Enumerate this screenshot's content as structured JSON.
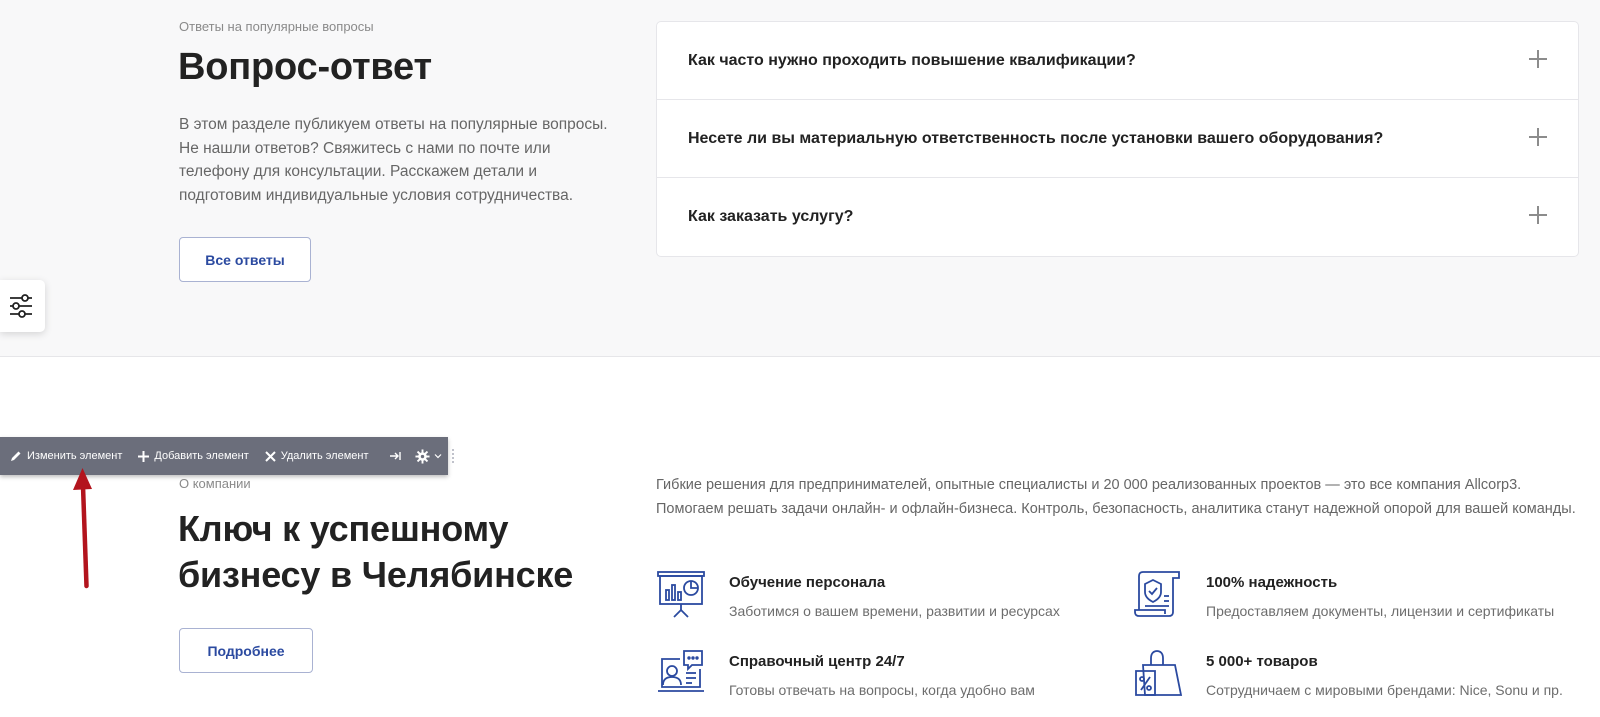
{
  "faq": {
    "caption": "Ответы на популярные вопросы",
    "title": "Вопрос-ответ",
    "description": "В этом разделе публикуем ответы на популярные вопросы. Не нашли ответов? Свяжитесь с нами по почте или телефону для консультации. Расскажем детали и подготовим индивидуальные условия сотрудничества.",
    "button_label": "Все ответы",
    "items": [
      {
        "question": "Как часто нужно проходить повышение квалификации?"
      },
      {
        "question": "Несете ли вы материальную ответственность после установки вашего оборудования?"
      },
      {
        "question": "Как заказать услугу?"
      }
    ]
  },
  "edit_toolbar": {
    "edit_label": "Изменить элемент",
    "add_label": "Добавить элемент",
    "delete_label": "Удалить элемент"
  },
  "about": {
    "caption": "О компании",
    "title": "Ключ к успешному бизнесу в Челябинске",
    "button_label": "Подробнее",
    "description": "Гибкие решения для предпринимателей, опытные специалисты и 20 000 реализованных проектов — это все компания Allcorp3. Помогаем решать задачи онлайн- и офлайн-бизнеса. Контроль, безопасность, аналитика станут надежной опорой для вашей команды.",
    "features": [
      {
        "icon": "presentation-board-icon",
        "title": "Обучение персонала",
        "desc": "Заботимся о вашем времени, развитии и ресурсах"
      },
      {
        "icon": "certificate-shield-icon",
        "title": "100% надежность",
        "desc": "Предоставляем документы, лицензии и сертификаты"
      },
      {
        "icon": "support-chat-icon",
        "title": "Справочный центр 24/7",
        "desc": "Готовы отвечать на вопросы, когда удобно вам"
      },
      {
        "icon": "shopping-bag-percent-icon",
        "title": "5 000+ товаров",
        "desc": "Сотрудничаем с мировыми брендами: Nice, Sonu и пр."
      }
    ]
  },
  "colors": {
    "accent": "#2b4aa0",
    "annotation_arrow": "#b3141d",
    "toolbar_bg": "#6b6e7b",
    "section_bg": "#f8f8f9"
  }
}
